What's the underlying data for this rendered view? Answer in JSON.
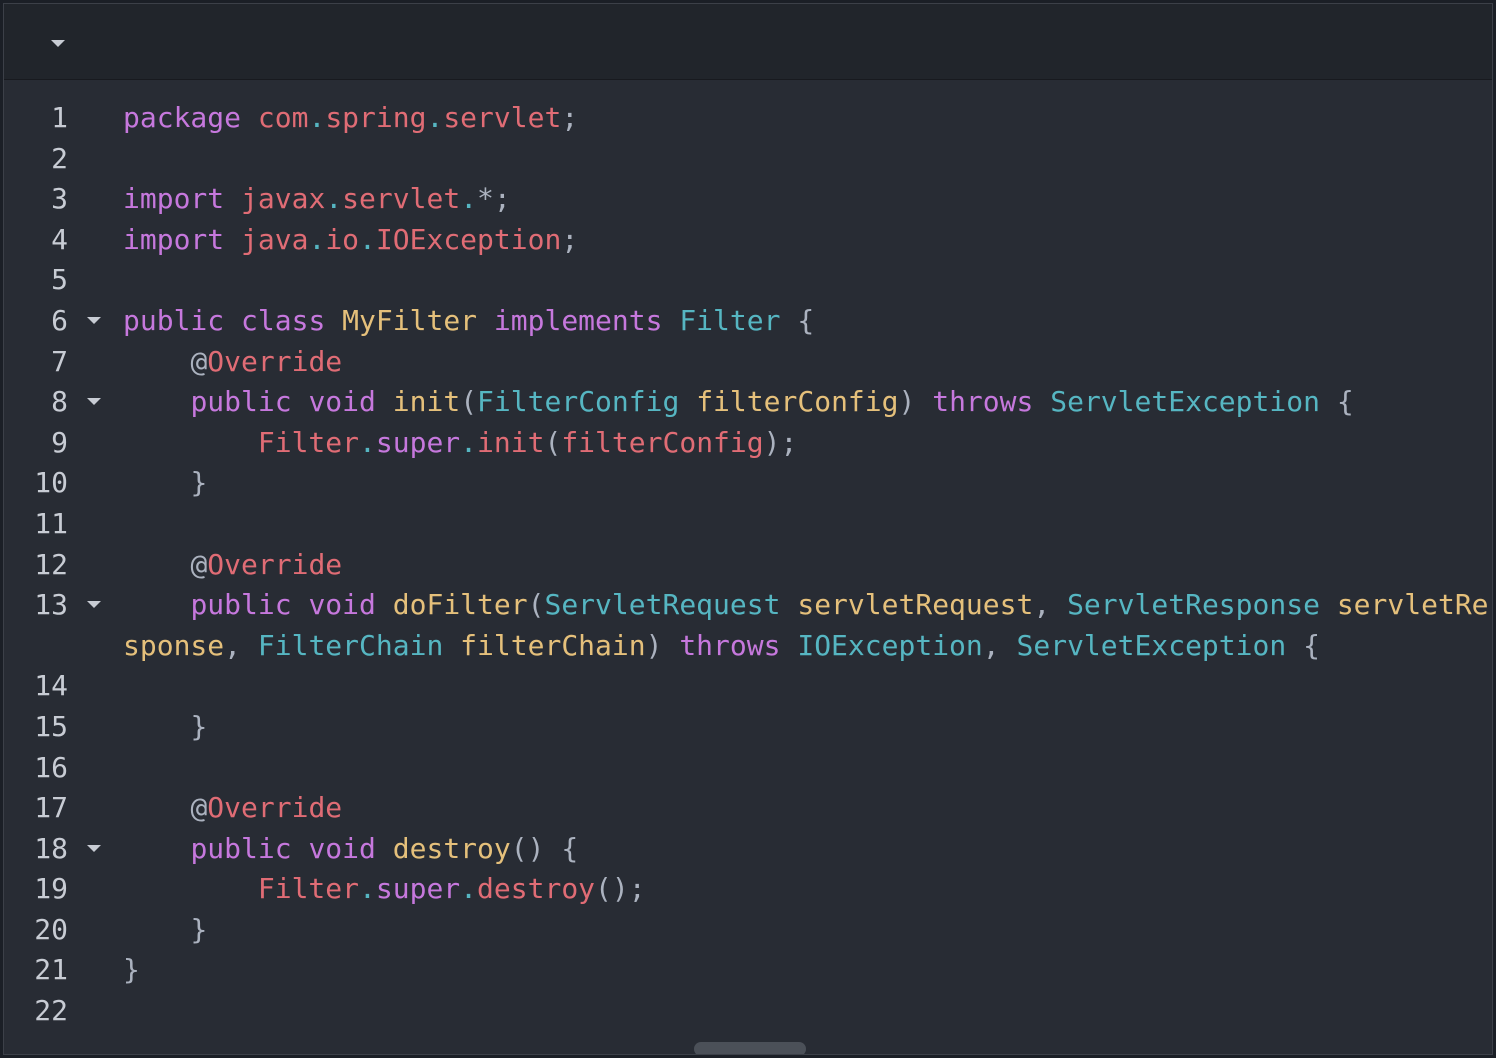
{
  "toolbar": {
    "collapse_icon": "caret-down-icon"
  },
  "colors": {
    "keyword": "#c678dd",
    "identifier": "#e06c75",
    "type": "#56b6c2",
    "function": "#e5c07b",
    "punctuation": "#abb2bf",
    "background": "#282c34"
  },
  "lines": [
    {
      "n": "1",
      "fold": false,
      "tokens": [
        [
          "package",
          "kw"
        ],
        [
          " ",
          ""
        ],
        [
          "com",
          "id"
        ],
        [
          ".",
          "dot"
        ],
        [
          "spring",
          "id"
        ],
        [
          ".",
          "dot"
        ],
        [
          "servlet",
          "id"
        ],
        [
          ";",
          "p"
        ]
      ]
    },
    {
      "n": "2",
      "fold": false,
      "tokens": []
    },
    {
      "n": "3",
      "fold": false,
      "tokens": [
        [
          "import",
          "kw"
        ],
        [
          " ",
          ""
        ],
        [
          "javax",
          "id"
        ],
        [
          ".",
          "dot"
        ],
        [
          "servlet",
          "id"
        ],
        [
          ".",
          "dot"
        ],
        [
          "*",
          "p"
        ],
        [
          ";",
          "p"
        ]
      ]
    },
    {
      "n": "4",
      "fold": false,
      "tokens": [
        [
          "import",
          "kw"
        ],
        [
          " ",
          ""
        ],
        [
          "java",
          "id"
        ],
        [
          ".",
          "dot"
        ],
        [
          "io",
          "id"
        ],
        [
          ".",
          "dot"
        ],
        [
          "IOException",
          "id"
        ],
        [
          ";",
          "p"
        ]
      ]
    },
    {
      "n": "5",
      "fold": false,
      "tokens": []
    },
    {
      "n": "6",
      "fold": true,
      "tokens": [
        [
          "public",
          "kw"
        ],
        [
          " ",
          ""
        ],
        [
          "class",
          "kw"
        ],
        [
          " ",
          ""
        ],
        [
          "MyFilter",
          "fn"
        ],
        [
          " ",
          ""
        ],
        [
          "implements",
          "kw"
        ],
        [
          " ",
          ""
        ],
        [
          "Filter",
          "ty"
        ],
        [
          " ",
          ""
        ],
        [
          "{",
          "p"
        ]
      ]
    },
    {
      "n": "7",
      "fold": false,
      "tokens": [
        [
          "    ",
          ""
        ],
        [
          "@",
          "p"
        ],
        [
          "Override",
          "id"
        ]
      ]
    },
    {
      "n": "8",
      "fold": true,
      "tokens": [
        [
          "    ",
          ""
        ],
        [
          "public",
          "kw"
        ],
        [
          " ",
          ""
        ],
        [
          "void",
          "kw"
        ],
        [
          " ",
          ""
        ],
        [
          "init",
          "fn"
        ],
        [
          "(",
          "p"
        ],
        [
          "FilterConfig",
          "ty"
        ],
        [
          " ",
          ""
        ],
        [
          "filterConfig",
          "fn"
        ],
        [
          ")",
          "p"
        ],
        [
          " ",
          ""
        ],
        [
          "throws",
          "kw"
        ],
        [
          " ",
          ""
        ],
        [
          "ServletException",
          "ty"
        ],
        [
          " ",
          ""
        ],
        [
          "{",
          "p"
        ]
      ]
    },
    {
      "n": "9",
      "fold": false,
      "tokens": [
        [
          "        ",
          ""
        ],
        [
          "Filter",
          "id"
        ],
        [
          ".",
          "dot"
        ],
        [
          "super",
          "kw"
        ],
        [
          ".",
          "dot"
        ],
        [
          "init",
          "id"
        ],
        [
          "(",
          "p"
        ],
        [
          "filterConfig",
          "id"
        ],
        [
          ")",
          "p"
        ],
        [
          ";",
          "p"
        ]
      ]
    },
    {
      "n": "10",
      "fold": false,
      "tokens": [
        [
          "    ",
          ""
        ],
        [
          "}",
          "p"
        ]
      ]
    },
    {
      "n": "11",
      "fold": false,
      "tokens": []
    },
    {
      "n": "12",
      "fold": false,
      "tokens": [
        [
          "    ",
          ""
        ],
        [
          "@",
          "p"
        ],
        [
          "Override",
          "id"
        ]
      ]
    },
    {
      "n": "13",
      "fold": true,
      "wrap": true,
      "tokens": [
        [
          "    ",
          ""
        ],
        [
          "public",
          "kw"
        ],
        [
          " ",
          ""
        ],
        [
          "void",
          "kw"
        ],
        [
          " ",
          ""
        ],
        [
          "doFilter",
          "fn"
        ],
        [
          "(",
          "p"
        ],
        [
          "ServletRequest",
          "ty"
        ],
        [
          " ",
          ""
        ],
        [
          "servletRequest",
          "fn"
        ],
        [
          ",",
          "p"
        ],
        [
          " ",
          ""
        ],
        [
          "ServletResponse",
          "ty"
        ],
        [
          " ",
          ""
        ],
        [
          "servletResponse",
          "fn"
        ],
        [
          ",",
          "p"
        ],
        [
          " ",
          ""
        ],
        [
          "FilterChain",
          "ty"
        ],
        [
          " ",
          ""
        ],
        [
          "filterChain",
          "fn"
        ],
        [
          ")",
          "p"
        ],
        [
          " ",
          ""
        ],
        [
          "throws",
          "kw"
        ],
        [
          " ",
          ""
        ],
        [
          "IOException",
          "ty"
        ],
        [
          ",",
          "p"
        ],
        [
          " ",
          ""
        ],
        [
          "ServletException",
          "ty"
        ],
        [
          " ",
          ""
        ],
        [
          "{",
          "p"
        ]
      ]
    },
    {
      "n": "14",
      "fold": false,
      "tokens": []
    },
    {
      "n": "15",
      "fold": false,
      "tokens": [
        [
          "    ",
          ""
        ],
        [
          "}",
          "p"
        ]
      ]
    },
    {
      "n": "16",
      "fold": false,
      "tokens": []
    },
    {
      "n": "17",
      "fold": false,
      "tokens": [
        [
          "    ",
          ""
        ],
        [
          "@",
          "p"
        ],
        [
          "Override",
          "id"
        ]
      ]
    },
    {
      "n": "18",
      "fold": true,
      "tokens": [
        [
          "    ",
          ""
        ],
        [
          "public",
          "kw"
        ],
        [
          " ",
          ""
        ],
        [
          "void",
          "kw"
        ],
        [
          " ",
          ""
        ],
        [
          "destroy",
          "fn"
        ],
        [
          "(",
          "p"
        ],
        [
          ")",
          "p"
        ],
        [
          " ",
          ""
        ],
        [
          "{",
          "p"
        ]
      ]
    },
    {
      "n": "19",
      "fold": false,
      "tokens": [
        [
          "        ",
          ""
        ],
        [
          "Filter",
          "id"
        ],
        [
          ".",
          "dot"
        ],
        [
          "super",
          "kw"
        ],
        [
          ".",
          "dot"
        ],
        [
          "destroy",
          "id"
        ],
        [
          "(",
          "p"
        ],
        [
          ")",
          "p"
        ],
        [
          ";",
          "p"
        ]
      ]
    },
    {
      "n": "20",
      "fold": false,
      "tokens": [
        [
          "    ",
          ""
        ],
        [
          "}",
          "p"
        ]
      ]
    },
    {
      "n": "21",
      "fold": false,
      "tokens": [
        [
          "}",
          "p"
        ]
      ]
    },
    {
      "n": "22",
      "fold": false,
      "tokens": []
    }
  ]
}
